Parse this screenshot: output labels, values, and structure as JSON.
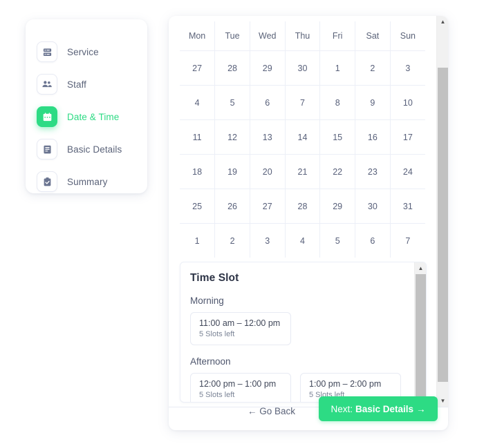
{
  "sidebar": {
    "items": [
      {
        "label": "Service",
        "icon": "server-icon",
        "active": false
      },
      {
        "label": "Staff",
        "icon": "people-icon",
        "active": false
      },
      {
        "label": "Date & Time",
        "icon": "calendar-icon",
        "active": true
      },
      {
        "label": "Basic Details",
        "icon": "document-icon",
        "active": false
      },
      {
        "label": "Summary",
        "icon": "clipboard-check-icon",
        "active": false
      }
    ]
  },
  "calendar": {
    "weekdays": [
      "Mon",
      "Tue",
      "Wed",
      "Thu",
      "Fri",
      "Sat",
      "Sun"
    ],
    "weeks": [
      [
        {
          "day": "27",
          "state": "muted"
        },
        {
          "day": "28",
          "state": "muted"
        },
        {
          "day": "29",
          "state": "muted"
        },
        {
          "day": "30",
          "state": "muted"
        },
        {
          "day": "1",
          "state": "muted"
        },
        {
          "day": "2",
          "state": "muted"
        },
        {
          "day": "3",
          "state": "muted"
        }
      ],
      [
        {
          "day": "4",
          "state": "muted"
        },
        {
          "day": "5",
          "state": "muted"
        },
        {
          "day": "6",
          "state": "today"
        },
        {
          "day": "7",
          "state": "normal"
        },
        {
          "day": "8",
          "state": "selected"
        },
        {
          "day": "9",
          "state": "weekend"
        },
        {
          "day": "10",
          "state": "weekend"
        }
      ],
      [
        {
          "day": "11",
          "state": "normal"
        },
        {
          "day": "12",
          "state": "normal"
        },
        {
          "day": "13",
          "state": "normal"
        },
        {
          "day": "14",
          "state": "normal"
        },
        {
          "day": "15",
          "state": "normal"
        },
        {
          "day": "16",
          "state": "weekend"
        },
        {
          "day": "17",
          "state": "weekend"
        }
      ],
      [
        {
          "day": "18",
          "state": "normal"
        },
        {
          "day": "19",
          "state": "normal"
        },
        {
          "day": "20",
          "state": "normal"
        },
        {
          "day": "21",
          "state": "normal"
        },
        {
          "day": "22",
          "state": "normal"
        },
        {
          "day": "23",
          "state": "weekend"
        },
        {
          "day": "24",
          "state": "weekend"
        }
      ],
      [
        {
          "day": "25",
          "state": "normal"
        },
        {
          "day": "26",
          "state": "normal"
        },
        {
          "day": "27",
          "state": "normal"
        },
        {
          "day": "28",
          "state": "normal"
        },
        {
          "day": "29",
          "state": "normal"
        },
        {
          "day": "30",
          "state": "weekend"
        },
        {
          "day": "31",
          "state": "weekend"
        }
      ],
      [
        {
          "day": "1",
          "state": "muted"
        },
        {
          "day": "2",
          "state": "muted"
        },
        {
          "day": "3",
          "state": "muted"
        },
        {
          "day": "4",
          "state": "muted"
        },
        {
          "day": "5",
          "state": "muted"
        },
        {
          "day": "6",
          "state": "muted"
        },
        {
          "day": "7",
          "state": "muted"
        }
      ]
    ]
  },
  "time_slot": {
    "title": "Time Slot",
    "periods": [
      {
        "label": "Morning",
        "slots": [
          {
            "time": "11:00 am – 12:00 pm",
            "availability": "5 Slots left"
          }
        ]
      },
      {
        "label": "Afternoon",
        "slots": [
          {
            "time": "12:00 pm – 1:00 pm",
            "availability": "5 Slots left"
          },
          {
            "time": "1:00 pm – 2:00 pm",
            "availability": "5 Slots left"
          }
        ]
      }
    ]
  },
  "footer": {
    "go_back_label": "← Go Back",
    "next_prefix": "Next:",
    "next_target": "Basic Details",
    "next_arrow": "→"
  },
  "colors": {
    "accent_green": "#2ddb84",
    "selected_day": "#4ecfa0",
    "today_bg": "#e0f8ee",
    "muted_text": "#c3c9d8",
    "body_text": "#5b6379"
  }
}
